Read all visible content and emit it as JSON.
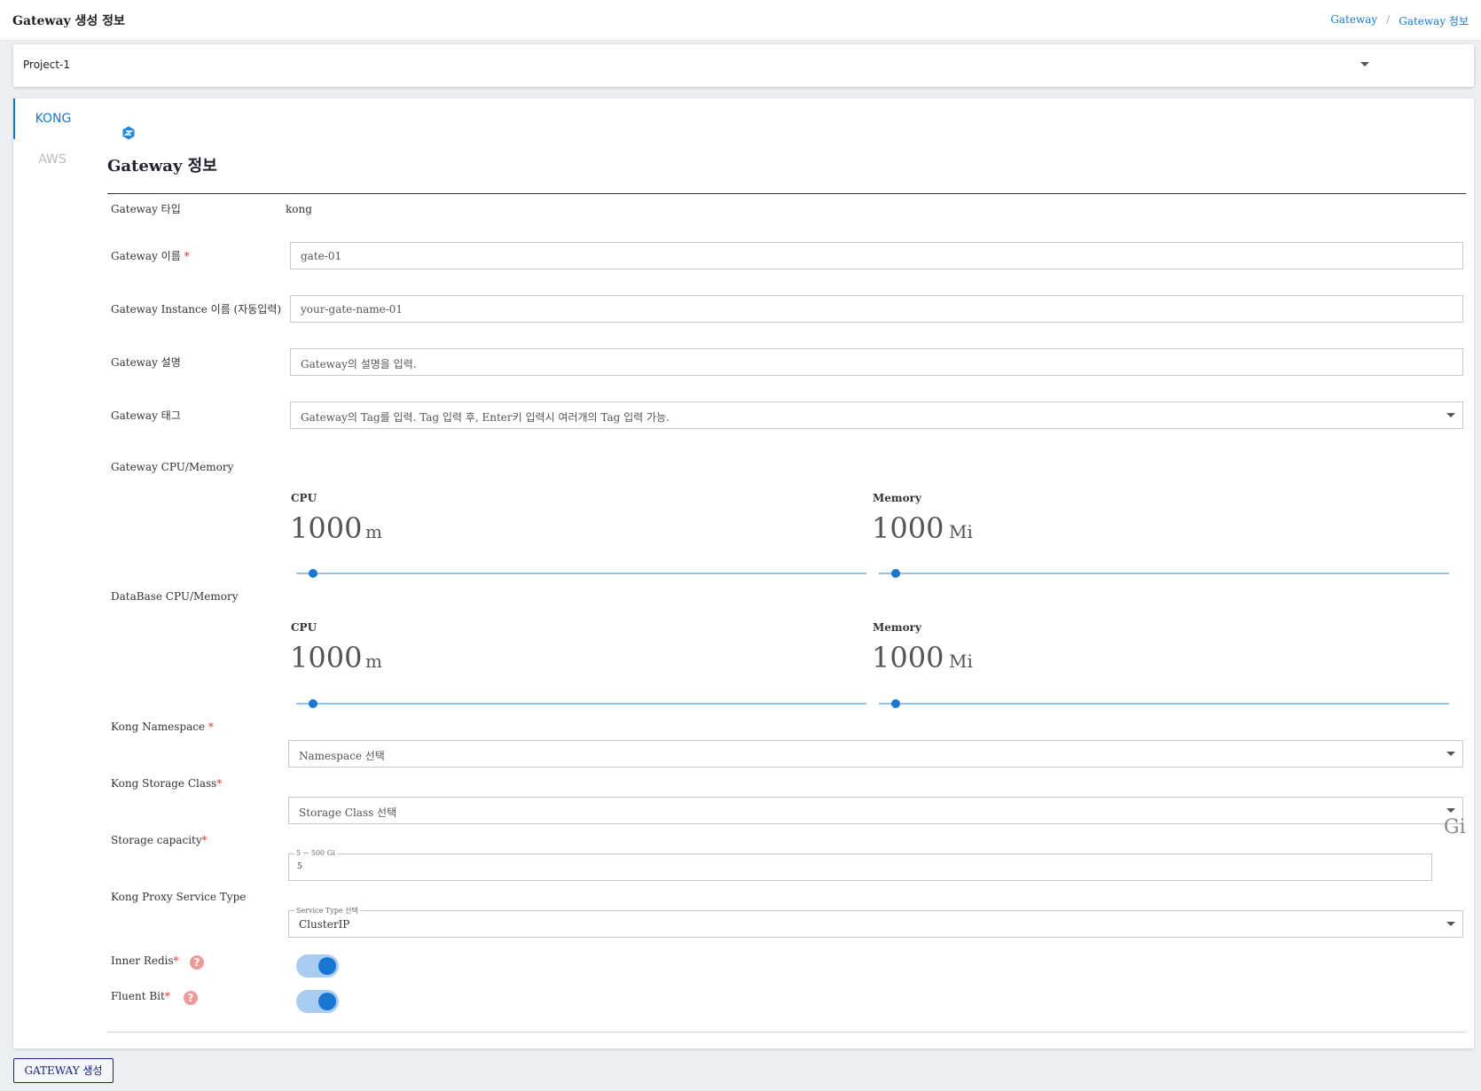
{
  "header": {
    "title": "Gateway 생성 정보",
    "breadcrumb": [
      "Gateway",
      "/",
      "Gateway 정보"
    ]
  },
  "project": {
    "selected": "Project-1"
  },
  "side_tabs": [
    {
      "label": "KONG",
      "active": true
    },
    {
      "label": "AWS",
      "active": false
    }
  ],
  "section": {
    "title": "Gateway 정보"
  },
  "form": {
    "type": {
      "label": "Gateway 타입",
      "value": "kong"
    },
    "name": {
      "label": "Gateway 이름",
      "required": "*",
      "value": "gate-01"
    },
    "instance_name": {
      "label": "Gateway Instance 이름 (자동입력)",
      "value": "your-gate-name-01"
    },
    "description": {
      "label": "Gateway 설명",
      "placeholder": "Gateway의 설명을 입력."
    },
    "tags": {
      "label": "Gateway 태그",
      "placeholder": "Gateway의 Tag를 입력. Tag 입력 후, Enter키 입력시 여러개의 Tag 입력 가능."
    },
    "gateway_resources": {
      "label": "Gateway CPU/Memory",
      "cpu": {
        "label": "CPU",
        "value": "1000",
        "unit": "m",
        "slider_fraction": 0.03
      },
      "memory": {
        "label": "Memory",
        "value": "1000",
        "unit": "Mi",
        "slider_fraction": 0.03
      }
    },
    "db_resources": {
      "label": "DataBase CPU/Memory",
      "cpu": {
        "label": "CPU",
        "value": "1000",
        "unit": "m",
        "slider_fraction": 0.03
      },
      "memory": {
        "label": "Memory",
        "value": "1000",
        "unit": "Mi",
        "slider_fraction": 0.03
      }
    },
    "namespace": {
      "label": "Kong Namespace",
      "required": "*",
      "placeholder": "Namespace 선택"
    },
    "storage_class": {
      "label": "Kong Storage Class",
      "required": "*",
      "placeholder": "Storage Class 선택"
    },
    "storage_capacity": {
      "label": "Storage capacity",
      "required": "*",
      "legend": "5 ~ 500 Gi",
      "value": "5",
      "unit": "Gi"
    },
    "proxy_service_type": {
      "label": "Kong Proxy Service Type",
      "legend": "Service Type 선택",
      "value": "ClusterIP"
    },
    "inner_redis": {
      "label": "Inner Redis",
      "required": "*",
      "help": "?",
      "enabled": true
    },
    "fluent_bit": {
      "label": "Fluent Bit",
      "required": "*",
      "help": "?",
      "enabled": true
    }
  },
  "actions": {
    "create_label": "GATEWAY 생성"
  },
  "colors": {
    "accent": "#1976d2",
    "required": "#e53935",
    "help": "#ef9a9a"
  }
}
